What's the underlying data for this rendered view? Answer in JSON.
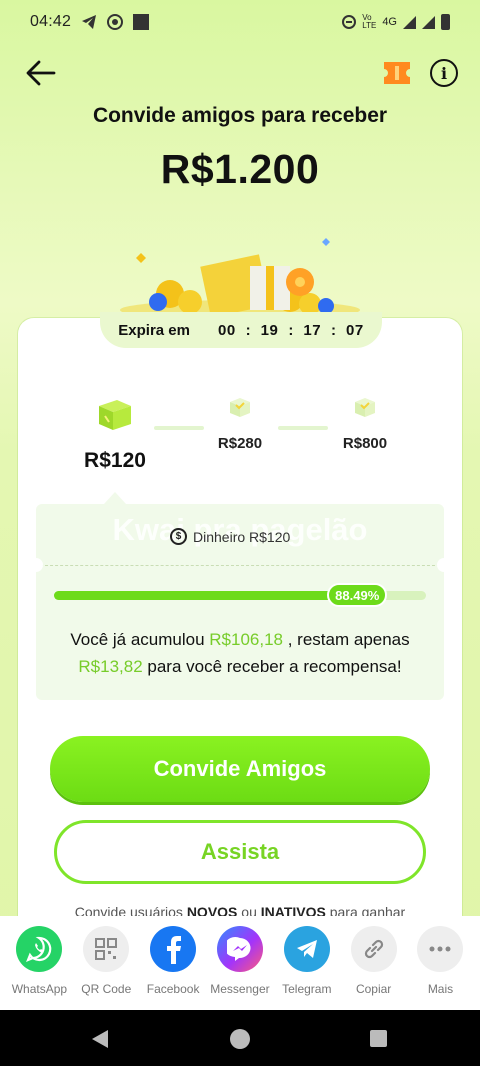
{
  "status_bar": {
    "time": "04:42",
    "network": "4G"
  },
  "header": {
    "title": "Convide amigos para receber",
    "amount": "R$1.200"
  },
  "expire": {
    "label": "Expira em",
    "hours": "00",
    "minutes": "19",
    "seconds": "17",
    "frames": "07"
  },
  "milestones": [
    {
      "label": "R$120",
      "state": "active"
    },
    {
      "label": "R$280",
      "state": "locked"
    },
    {
      "label": "R$800",
      "state": "locked"
    }
  ],
  "panel": {
    "banner": "Kwai pra pagelão",
    "coin_label": "Dinheiro R$120",
    "progress_percent": 88.49,
    "progress_label": "88.49%",
    "text_prefix": "Você já acumulou ",
    "accumulated": "R$106,18",
    "text_middle": " , restam apenas ",
    "remaining": "R$13,82",
    "text_suffix": " para você receber a recompensa!"
  },
  "buttons": {
    "invite": "Convide Amigos",
    "watch": "Assista"
  },
  "footnote": {
    "prefix": "Convide usuários ",
    "bold1": "NOVOS",
    "mid": " ou ",
    "bold2": "INATIVOS",
    "suffix": " para ganhar"
  },
  "share": [
    {
      "label": "WhatsApp",
      "icon": "whatsapp-icon",
      "color": "#25d366"
    },
    {
      "label": "QR Code",
      "icon": "qr-code-icon",
      "color": "#eeeeee"
    },
    {
      "label": "Facebook",
      "icon": "facebook-icon",
      "color": "#1877f2"
    },
    {
      "label": "Messenger",
      "icon": "messenger-icon",
      "color": "#a334fa"
    },
    {
      "label": "Telegram",
      "icon": "telegram-icon",
      "color": "#2aa3e0"
    },
    {
      "label": "Copiar",
      "icon": "link-icon",
      "color": "#eeeeee"
    },
    {
      "label": "Mais",
      "icon": "more-icon",
      "color": "#eeeeee"
    }
  ],
  "colors": {
    "accent": "#6ddb1a",
    "accent_text": "#77cc2a",
    "background": "#e6f9b8"
  }
}
